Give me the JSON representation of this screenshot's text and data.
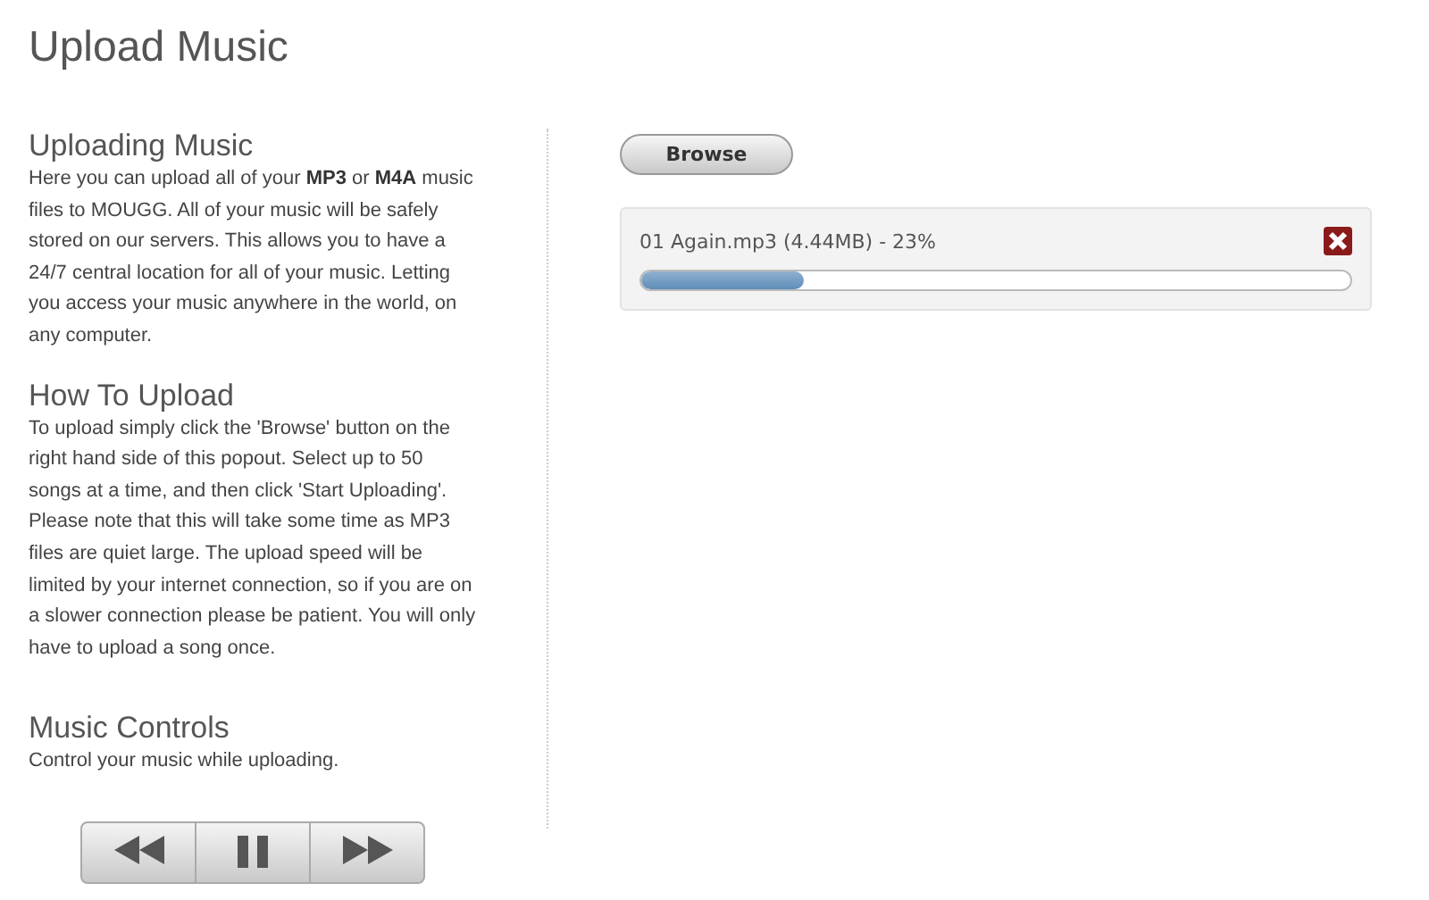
{
  "title": "Upload Music",
  "info_sections": [
    {
      "heading": "Uploading Music",
      "text": "Here you can upload all of your **MP3** or **M4A** music files to MOUGG. All of your music will be safely stored on our servers. This allows you to have a 24/7 central location for all of your music. Letting you access your music anywhere in the world, on any computer."
    },
    {
      "heading": "How To Upload",
      "text": "To upload simply click the 'Browse' button on the right hand side of this popout. Select up to 50 songs at a time, and then click 'Start Uploading'. Please note that this will take some time as MP3 files are quiet large. The upload speed will be limited by your internet connection, so if you are on a slower connection please be patient. You will only have to upload a song once."
    },
    {
      "heading": "Music Controls",
      "text": "Control your music while uploading."
    }
  ],
  "controls": [
    {
      "kind": "rewind"
    },
    {
      "kind": "pause"
    },
    {
      "kind": "forward"
    }
  ],
  "browse_button": "Browse",
  "uploads": [
    {
      "label": "01 Again.mp3 (4.44MB) - 23%",
      "level": 0.23
    }
  ]
}
